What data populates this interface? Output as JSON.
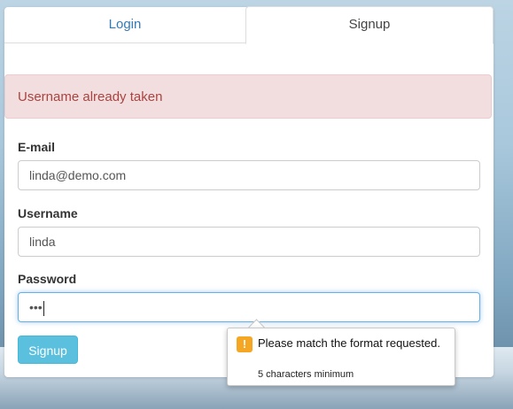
{
  "tabs": {
    "login_label": "Login",
    "signup_label": "Signup"
  },
  "alert": {
    "message": "Username already taken"
  },
  "form": {
    "email": {
      "label": "E-mail",
      "value": "linda@demo.com"
    },
    "username": {
      "label": "Username",
      "value": "linda"
    },
    "password": {
      "label": "Password",
      "value": "•••"
    },
    "submit_label": "Signup"
  },
  "validation_tooltip": {
    "icon": "warning-icon",
    "message": "Please match the format requested.",
    "detail": "5 characters minimum"
  },
  "colors": {
    "link": "#337ab7",
    "alert_bg": "#f2dede",
    "alert_text": "#a94442",
    "button_bg": "#5bc0de",
    "focus_border": "#66afe9",
    "warning": "#f5a623"
  }
}
